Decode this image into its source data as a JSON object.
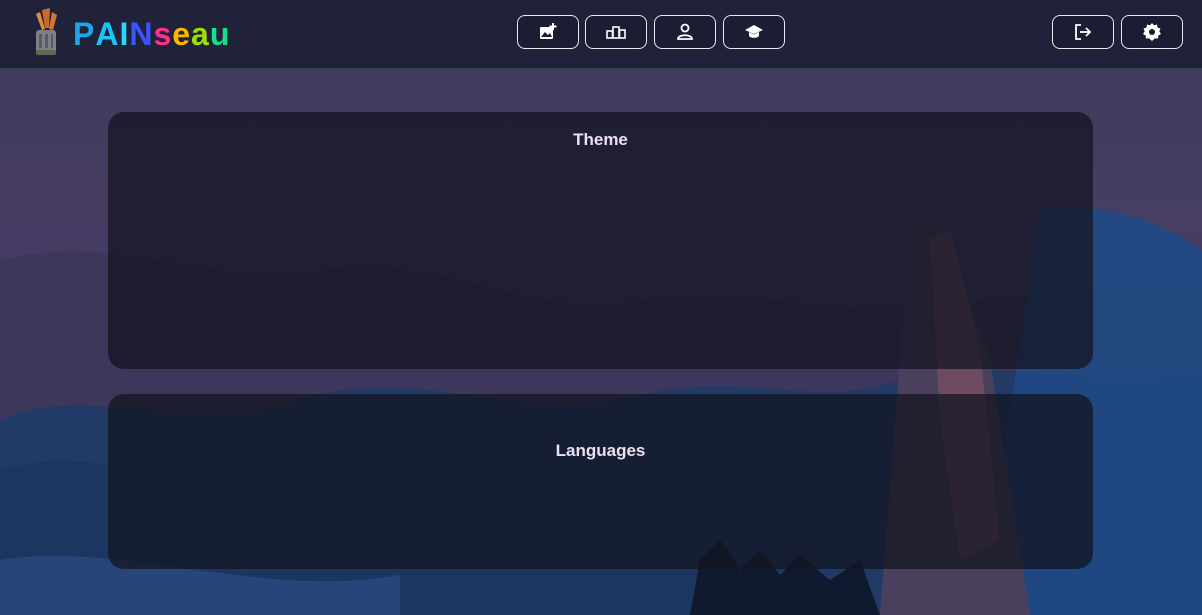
{
  "app": {
    "logo_text": [
      "P",
      "A",
      "I",
      "N",
      "s",
      "e",
      "a",
      "u"
    ],
    "logo_colors": [
      "#1aa7f0",
      "#19c5f5",
      "#29d6ff",
      "#3a55ff",
      "#ff2f8a",
      "#ffb400",
      "#9be000",
      "#17e08a"
    ]
  },
  "toolbar": {
    "buttons": [
      {
        "icon": "add-image-icon"
      },
      {
        "icon": "podium-icon"
      },
      {
        "icon": "user-icon"
      },
      {
        "icon": "graduation-cap-icon"
      }
    ],
    "right_buttons": [
      {
        "icon": "logout-icon"
      },
      {
        "icon": "gear-icon"
      }
    ]
  },
  "sections": {
    "theme_title": "Theme",
    "languages_title": "Languages"
  },
  "colors": {
    "header_bg": "#1f2238",
    "panel_bg": "rgba(18,19,32,0.72)",
    "title_text": "#ecdff0",
    "button_border": "#e9e9ef"
  }
}
